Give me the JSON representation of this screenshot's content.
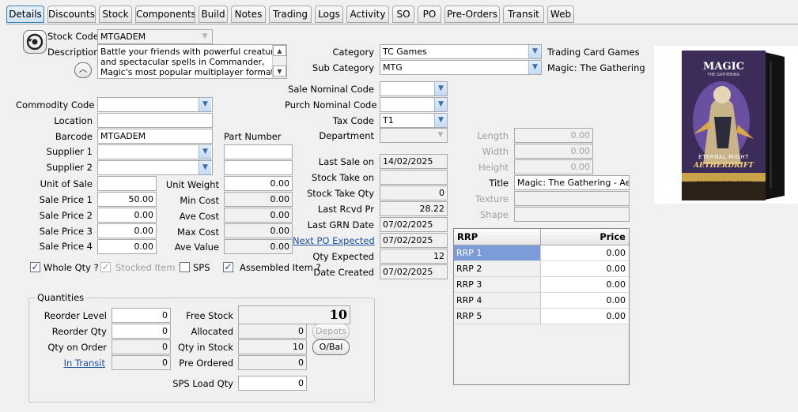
{
  "tabs": [
    {
      "label": "Details",
      "active": true
    },
    {
      "label": "Discounts"
    },
    {
      "label": "Stock"
    },
    {
      "label": "Components"
    },
    {
      "label": "Build"
    },
    {
      "label": "Notes"
    },
    {
      "label": "Trading"
    },
    {
      "label": "Logs"
    },
    {
      "label": "Activity"
    },
    {
      "label": "SO"
    },
    {
      "label": "PO"
    },
    {
      "label": "Pre-Orders"
    },
    {
      "label": "Transit"
    },
    {
      "label": "Web"
    }
  ],
  "stock_code": {
    "label": "Stock Code",
    "value": "MTGADEM"
  },
  "description": {
    "label": "Description",
    "value": "Battle your friends with powerful creatures\nand spectacular spells in Commander,\nMagic's most popular multiplayer format."
  },
  "category": {
    "label": "Category",
    "value": "TC Games",
    "name": "Trading Card  Games"
  },
  "sub_category": {
    "label": "Sub Category",
    "value": "MTG",
    "name": "Magic: The Gathering"
  },
  "sale_nominal_code": {
    "label": "Sale Nominal Code",
    "value": ""
  },
  "purch_nominal_code": {
    "label": "Purch Nominal Code",
    "value": ""
  },
  "tax_code": {
    "label": "Tax Code",
    "value": "T1"
  },
  "department": {
    "label": "Department",
    "value": ""
  },
  "commodity_code": {
    "label": "Commodity Code",
    "value": ""
  },
  "location": {
    "label": "Location",
    "value": ""
  },
  "barcode": {
    "label": "Barcode",
    "value": "MTGADEM"
  },
  "part_number": {
    "label": "Part Number"
  },
  "supplier1": {
    "label": "Supplier 1",
    "value": "",
    "part": ""
  },
  "supplier2": {
    "label": "Supplier 2",
    "value": "",
    "part": ""
  },
  "unit_of_sale": {
    "label": "Unit of Sale",
    "value": ""
  },
  "unit_weight": {
    "label": "Unit Weight",
    "value": "0.00"
  },
  "sale_price_1": {
    "label": "Sale Price 1",
    "value": "50.00"
  },
  "sale_price_2": {
    "label": "Sale Price 2",
    "value": "0.00"
  },
  "sale_price_3": {
    "label": "Sale Price 3",
    "value": "0.00"
  },
  "sale_price_4": {
    "label": "Sale Price 4",
    "value": "0.00"
  },
  "min_cost": {
    "label": "Min Cost",
    "value": "0.00"
  },
  "ave_cost": {
    "label": "Ave Cost",
    "value": "0.00"
  },
  "max_cost": {
    "label": "Max Cost",
    "value": "0.00"
  },
  "ave_value": {
    "label": "Ave Value",
    "value": "0.00"
  },
  "checkboxes": {
    "whole_qty": {
      "label": "Whole Qty ?",
      "checked": true
    },
    "stocked_item": {
      "label": "Stocked Item ?",
      "checked": true,
      "disabled": true
    },
    "sps": {
      "label": "SPS",
      "checked": false
    },
    "assembled_item": {
      "label": "Assembled Item ?",
      "checked": true
    }
  },
  "last_sale_on": {
    "label": "Last Sale on",
    "value": "14/02/2025"
  },
  "stock_take_on": {
    "label": "Stock Take on",
    "value": ""
  },
  "stock_take_qty": {
    "label": "Stock Take Qty",
    "value": "0"
  },
  "last_rcvd_pr": {
    "label": "Last Rcvd Pr",
    "value": "28.22"
  },
  "last_grn_date": {
    "label": "Last GRN Date",
    "value": "07/02/2025"
  },
  "next_po_expected": {
    "label": "Next PO Expected",
    "value": "07/02/2025"
  },
  "qty_expected": {
    "label": "Qty Expected",
    "value": "12"
  },
  "date_created": {
    "label": "Date Created",
    "value": "07/02/2025"
  },
  "length": {
    "label": "Length",
    "value": "0.00"
  },
  "width": {
    "label": "Width",
    "value": "0.00"
  },
  "height": {
    "label": "Height",
    "value": "0.00"
  },
  "title": {
    "label": "Title",
    "value": "Magic: The Gathering - Aethe"
  },
  "texture": {
    "label": "Texture",
    "value": ""
  },
  "shape": {
    "label": "Shape",
    "value": ""
  },
  "rrp": {
    "col_name": "RRP",
    "col_price": "Price",
    "rows": [
      {
        "name": "RRP 1",
        "price": "0.00"
      },
      {
        "name": "RRP 2",
        "price": "0.00"
      },
      {
        "name": "RRP 3",
        "price": "0.00"
      },
      {
        "name": "RRP 4",
        "price": "0.00"
      },
      {
        "name": "RRP 5",
        "price": "0.00"
      }
    ]
  },
  "quantities": {
    "title": "Quantities",
    "reorder_level": {
      "label": "Reorder Level",
      "value": "0"
    },
    "reorder_qty": {
      "label": "Reorder Qty",
      "value": "0"
    },
    "qty_on_order": {
      "label": "Qty on Order",
      "value": "0"
    },
    "in_transit": {
      "label": "In Transit",
      "value": "0"
    },
    "free_stock": {
      "label": "Free Stock",
      "value": "10"
    },
    "allocated": {
      "label": "Allocated",
      "value": "0"
    },
    "qty_in_stock": {
      "label": "Qty in Stock",
      "value": "10"
    },
    "pre_ordered": {
      "label": "Pre Ordered",
      "value": "0"
    },
    "sps_load_qty": {
      "label": "SPS Load Qty",
      "value": "0"
    },
    "depots_button": "Depots",
    "obal_button": "O/Bal"
  },
  "product_image": {
    "brand": "MAGIC",
    "brand_sub": "THE GATHERING",
    "deck_name": "ETERNAL MIGHT",
    "set_name": "AETHERDRIFT",
    "product_type": "COMMANDER DECK"
  },
  "colors": {
    "accent": "#3c7fb1",
    "link": "#1a4fa0",
    "selected_row": "#7c9bd9"
  }
}
